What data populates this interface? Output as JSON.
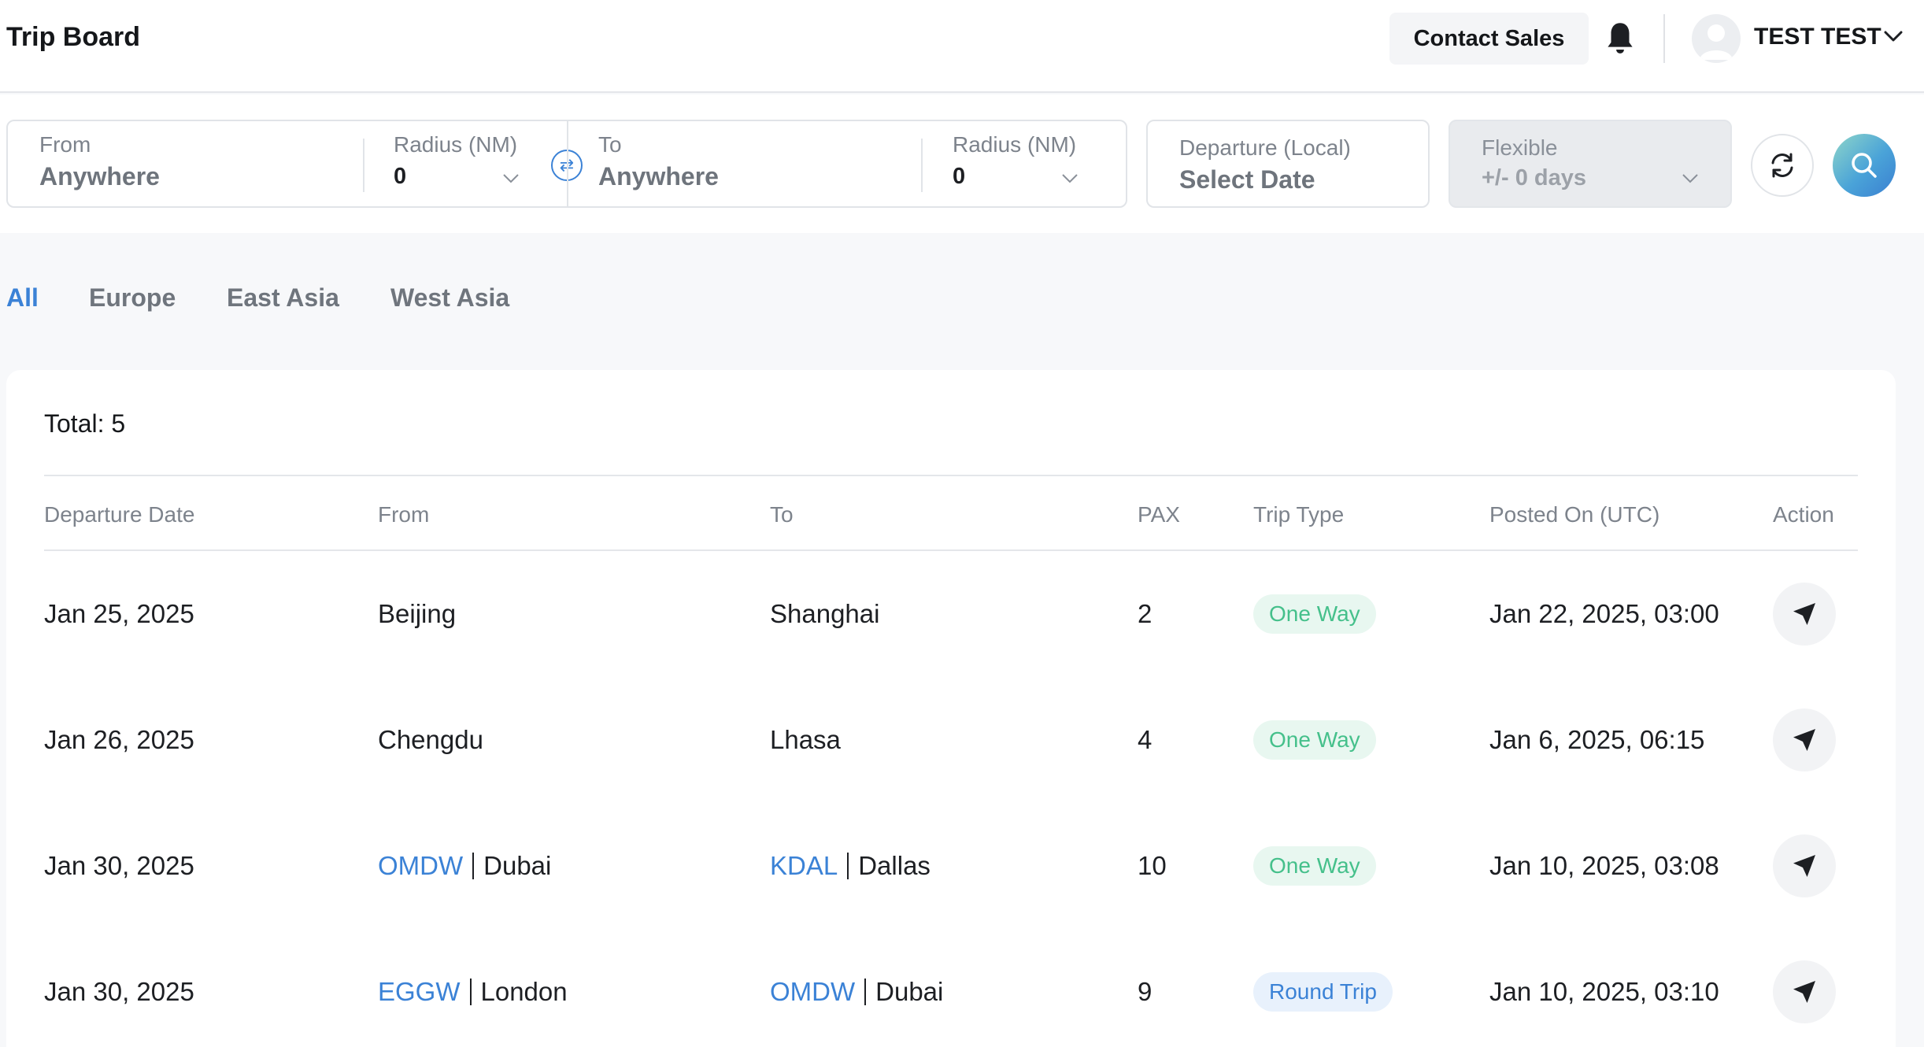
{
  "header": {
    "title": "Trip Board",
    "contact_sales": "Contact Sales",
    "username": "TEST TEST"
  },
  "search": {
    "from_label": "From",
    "from_value": "Anywhere",
    "from_radius_label": "Radius (NM)",
    "from_radius_value": "0",
    "to_label": "To",
    "to_value": "Anywhere",
    "to_radius_label": "Radius (NM)",
    "to_radius_value": "0",
    "departure_label": "Departure (Local)",
    "departure_value": "Select Date",
    "flexible_label": "Flexible",
    "flexible_value": "+/- 0 days"
  },
  "tabs": [
    {
      "label": "All",
      "active": true
    },
    {
      "label": "Europe",
      "active": false
    },
    {
      "label": "East Asia",
      "active": false
    },
    {
      "label": "West Asia",
      "active": false
    }
  ],
  "table": {
    "total": "Total: 5",
    "columns": [
      "Departure Date",
      "From",
      "To",
      "PAX",
      "Trip Type",
      "Posted On (UTC)",
      "Action"
    ],
    "rows": [
      {
        "date": "Jan 25, 2025",
        "from_code": "",
        "from_city": "Beijing",
        "to_code": "",
        "to_city": "Shanghai",
        "pax": "2",
        "trip_type": "One Way",
        "posted": "Jan 22, 2025, 03:00"
      },
      {
        "date": "Jan 26, 2025",
        "from_code": "",
        "from_city": "Chengdu",
        "to_code": "",
        "to_city": "Lhasa",
        "pax": "4",
        "trip_type": "One Way",
        "posted": "Jan 6, 2025, 06:15"
      },
      {
        "date": "Jan 30, 2025",
        "from_code": "OMDW",
        "from_city": "Dubai",
        "to_code": "KDAL",
        "to_city": "Dallas",
        "pax": "10",
        "trip_type": "One Way",
        "posted": "Jan 10, 2025, 03:08"
      },
      {
        "date": "Jan 30, 2025",
        "from_code": "EGGW",
        "from_city": "London",
        "to_code": "OMDW",
        "to_city": "Dubai",
        "pax": "9",
        "trip_type": "Round Trip",
        "posted": "Jan 10, 2025, 03:10"
      }
    ]
  },
  "colors": {
    "accent": "#3b82d6",
    "one_way": "#45c08b",
    "round_trip": "#3b82d6"
  },
  "icons": {
    "bell": "bell-icon",
    "swap": "swap-icon",
    "reset": "refresh-icon",
    "search": "search-icon",
    "action": "send-icon",
    "chevron": "chevron-down-icon"
  }
}
